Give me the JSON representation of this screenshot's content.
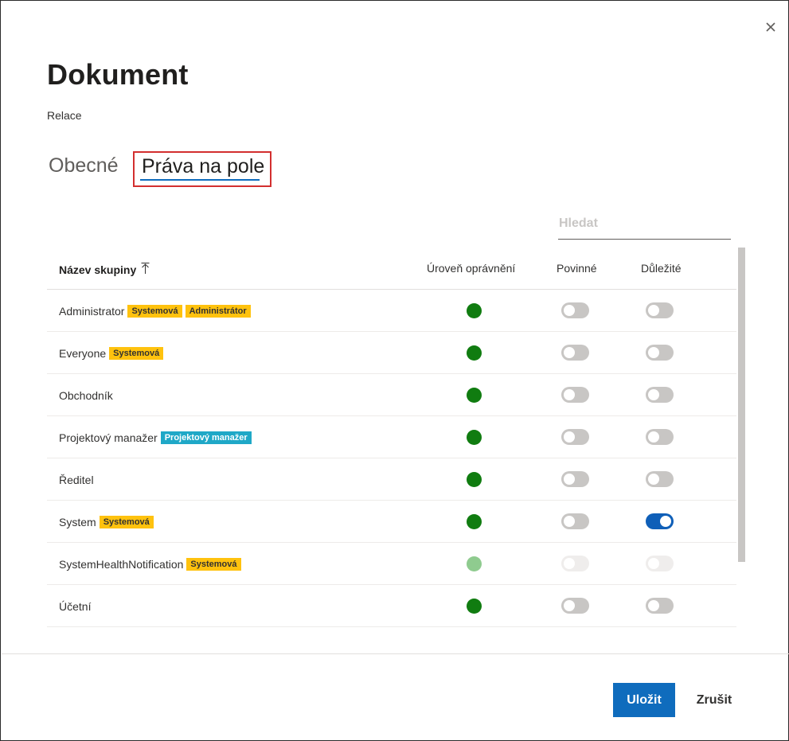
{
  "dialog": {
    "title": "Dokument",
    "subtitle": "Relace",
    "close_icon": "close-icon"
  },
  "tabs": [
    {
      "label": "Obecné",
      "selected": false
    },
    {
      "label": "Práva na pole",
      "selected": true
    }
  ],
  "search": {
    "placeholder": "Hledat",
    "value": ""
  },
  "table": {
    "columns": {
      "name": "Název skupiny",
      "level": "Úroveň oprávnění",
      "required": "Povinné",
      "important": "Důležité"
    },
    "sort_icon": "sort-ascending-icon",
    "rows": [
      {
        "name": "Administrator",
        "badges": [
          {
            "text": "Systemová",
            "color": "#ffc20e"
          },
          {
            "text": "Administrátor",
            "color": "#ffc20e"
          }
        ],
        "level_color": "#107c10",
        "required": false,
        "important": false,
        "disabled": false
      },
      {
        "name": "Everyone",
        "badges": [
          {
            "text": "Systemová",
            "color": "#ffc20e"
          }
        ],
        "level_color": "#107c10",
        "required": false,
        "important": false,
        "disabled": false
      },
      {
        "name": "Obchodník",
        "badges": [],
        "level_color": "#107c10",
        "required": false,
        "important": false,
        "disabled": false
      },
      {
        "name": "Projektový manažer",
        "badges": [
          {
            "text": "Projektový manažer",
            "color": "#1fa8c7"
          }
        ],
        "level_color": "#107c10",
        "required": false,
        "important": false,
        "disabled": false
      },
      {
        "name": "Ředitel",
        "badges": [],
        "level_color": "#107c10",
        "required": false,
        "important": false,
        "disabled": false
      },
      {
        "name": "System",
        "badges": [
          {
            "text": "Systemová",
            "color": "#ffc20e"
          }
        ],
        "level_color": "#107c10",
        "required": false,
        "important": true,
        "disabled": false
      },
      {
        "name": "SystemHealthNotification",
        "badges": [
          {
            "text": "Systemová",
            "color": "#ffc20e"
          }
        ],
        "level_color": "#8fcb8f",
        "required": false,
        "important": false,
        "disabled": true
      },
      {
        "name": "Účetní",
        "badges": [],
        "level_color": "#107c10",
        "required": false,
        "important": false,
        "disabled": false
      }
    ]
  },
  "footer": {
    "save_label": "Uložit",
    "cancel_label": "Zrušit"
  },
  "colors": {
    "accent": "#0f6cbd",
    "highlight_border": "#d32f2f"
  }
}
